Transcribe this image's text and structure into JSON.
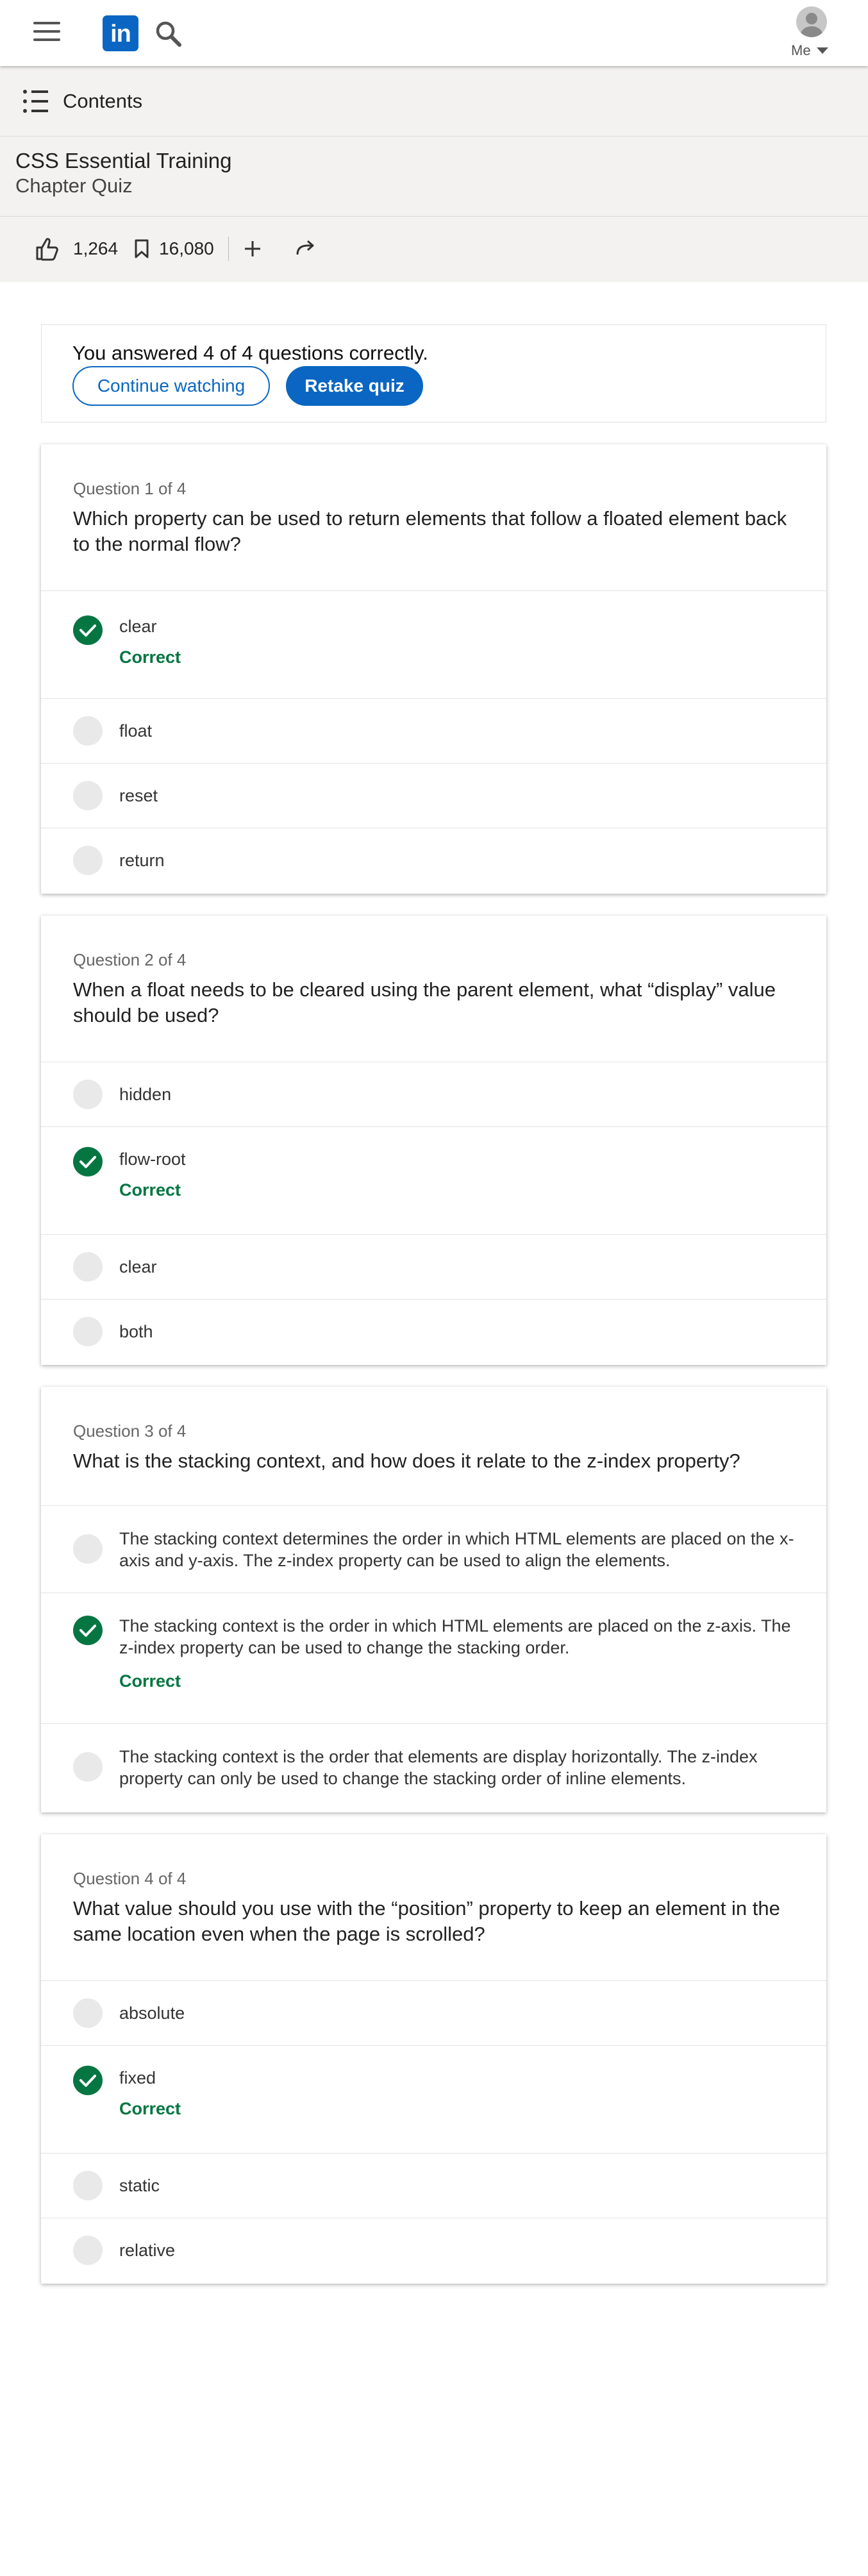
{
  "header": {
    "logo_text": "in",
    "me_label": "Me",
    "icons": [
      "menu-icon",
      "linkedin-logo",
      "search-icon",
      "avatar",
      "caret-down-icon"
    ]
  },
  "course": {
    "contents_label": "Contents",
    "title": "CSS Essential Training",
    "subtitle": "Chapter Quiz",
    "likes": "1,264",
    "saves": "16,080",
    "icons": [
      "thumbs-up-icon",
      "bookmark-icon",
      "plus-icon",
      "share-icon"
    ]
  },
  "result": {
    "message": "You answered 4 of 4 questions correctly.",
    "continue_label": "Continue watching",
    "retake_label": "Retake quiz"
  },
  "correct_label": "Correct",
  "questions": [
    {
      "number": "Question 1 of 4",
      "text": "Which property can be used to return elements that follow a floated element back to the normal flow?",
      "options": [
        {
          "text": "clear",
          "correct": true
        },
        {
          "text": "float",
          "correct": false
        },
        {
          "text": "reset",
          "correct": false
        },
        {
          "text": "return",
          "correct": false
        }
      ]
    },
    {
      "number": "Question 2 of 4",
      "text": "When a float needs to be cleared using the parent element, what “display” value should be used?",
      "options": [
        {
          "text": "hidden",
          "correct": false
        },
        {
          "text": "flow-root",
          "correct": true
        },
        {
          "text": "clear",
          "correct": false
        },
        {
          "text": "both",
          "correct": false
        }
      ]
    },
    {
      "number": "Question 3 of 4",
      "text": "What is the stacking context, and how does it relate to the z-index property?",
      "options": [
        {
          "text": "The stacking context determines the order in which HTML elements are placed on the x-axis and y-axis. The z-index property can be used to align the elements.",
          "correct": false
        },
        {
          "text": "The stacking context is the order in which HTML elements are placed on the z-axis. The z-index property can be used to change the stacking order.",
          "correct": true
        },
        {
          "text": "The stacking context is the order that elements are display horizontally. The z-index property can only be used to change the stacking order of inline elements.",
          "correct": false
        }
      ]
    },
    {
      "number": "Question 4 of 4",
      "text": "What value should you use with the “position” property to keep an element in the same location even when the page is scrolled?",
      "options": [
        {
          "text": "absolute",
          "correct": false
        },
        {
          "text": "fixed",
          "correct": true
        },
        {
          "text": "static",
          "correct": false
        },
        {
          "text": "relative",
          "correct": false
        }
      ]
    }
  ],
  "colors": {
    "brand": "#0a66c2",
    "correct": "#057642",
    "band_bg": "#f3f2f0"
  }
}
